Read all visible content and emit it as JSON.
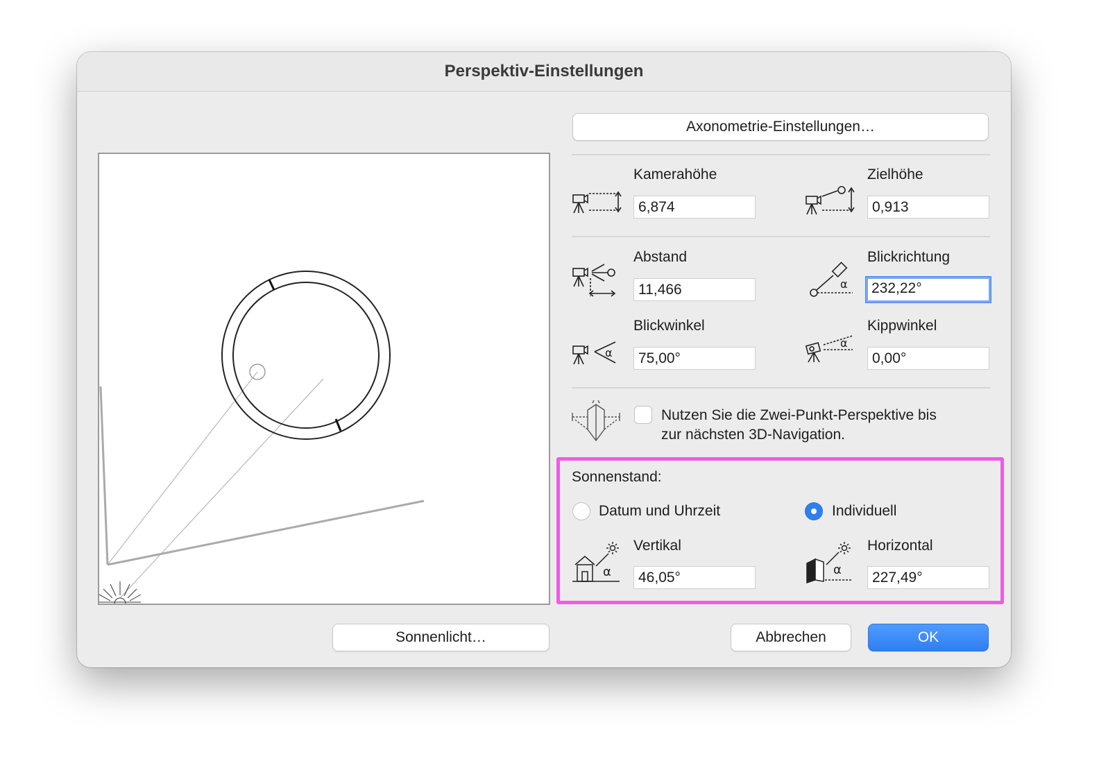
{
  "dialog": {
    "title": "Perspektiv-Einstellungen",
    "axonometry_button": "Axonometrie-Einstellungen…",
    "sunlight_button": "Sonnenlicht…",
    "cancel_button": "Abbrechen",
    "ok_button": "OK"
  },
  "fields": {
    "camera_height": {
      "label": "Kamerahöhe",
      "value": "6,874"
    },
    "target_height": {
      "label": "Zielhöhe",
      "value": "0,913"
    },
    "distance": {
      "label": "Abstand",
      "value": "11,466"
    },
    "view_direction": {
      "label": "Blickrichtung",
      "value": "232,22°"
    },
    "view_angle": {
      "label": "Blickwinkel",
      "value": "75,00°"
    },
    "tilt_angle": {
      "label": "Kippwinkel",
      "value": "0,00°"
    }
  },
  "two_point": {
    "label_line1": "Nutzen Sie die Zwei-Punkt-Perspektive bis",
    "label_line2": "zur nächsten 3D-Navigation.",
    "checked": false
  },
  "sun": {
    "title": "Sonnenstand:",
    "option_date": "Datum und Uhrzeit",
    "option_custom": "Individuell",
    "selected": "Individuell",
    "vertical": {
      "label": "Vertikal",
      "value": "46,05°"
    },
    "horizontal": {
      "label": "Horizontal",
      "value": "227,49°"
    }
  },
  "colors": {
    "accent": "#2f7ff0",
    "highlight": "#ee5ce5"
  },
  "icons": [
    "camera-height-icon",
    "target-height-icon",
    "distance-icon",
    "view-direction-icon",
    "view-angle-icon",
    "tilt-angle-icon",
    "two-point-perspective-icon",
    "sun-vertical-icon",
    "sun-horizontal-icon",
    "sun-icon"
  ]
}
